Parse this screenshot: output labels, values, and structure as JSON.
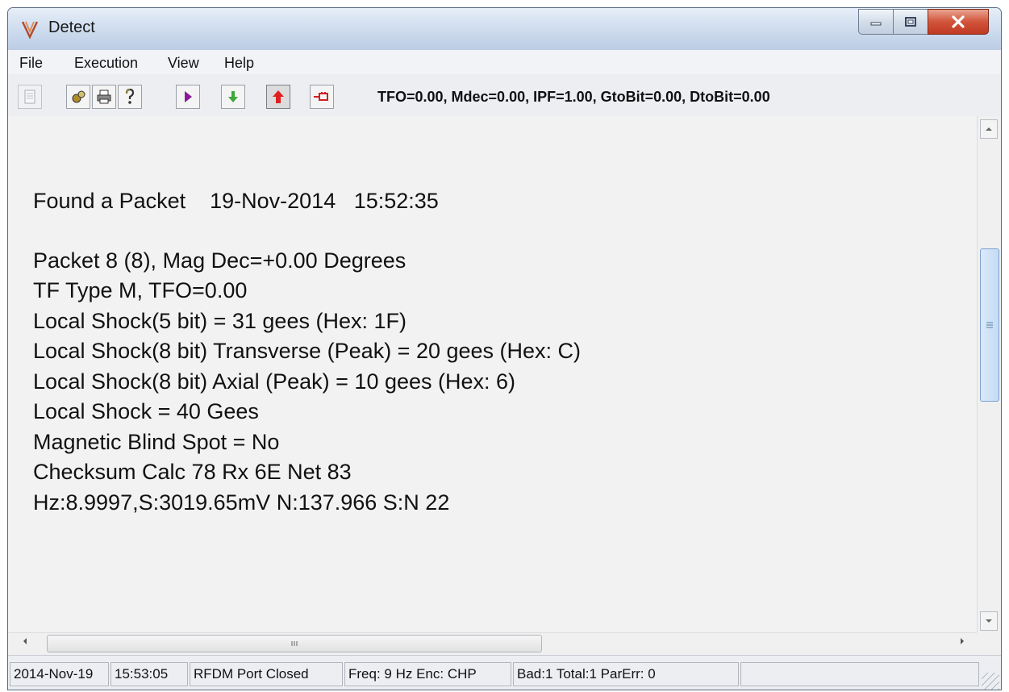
{
  "window": {
    "title": "Detect",
    "controls": [
      "minimize-icon",
      "maximize-icon",
      "close-icon"
    ]
  },
  "menu": {
    "items": [
      {
        "label": "File"
      },
      {
        "label": "Execution"
      },
      {
        "label": "View"
      },
      {
        "label": "Help"
      }
    ]
  },
  "toolbar": {
    "icons": [
      "document-icon",
      "tools-icon",
      "print-icon",
      "help-icon",
      "play-icon",
      "down-arrow-icon",
      "up-arrow-icon",
      "connector-icon"
    ],
    "status": "TFO=0.00, Mdec=0.00, IPF=1.00, GtoBit=0.00, DtoBit=0.00"
  },
  "content": {
    "lines": [
      "Found a Packet    19-Nov-2014   15:52:35",
      "Packet 8 (8), Mag Dec=+0.00 Degrees",
      "TF Type M, TFO=0.00",
      "Local Shock(5 bit) = 31 gees (Hex: 1F)",
      "Local Shock(8 bit) Transverse (Peak) = 20 gees (Hex: C)",
      "Local Shock(8 bit) Axial (Peak) = 10 gees (Hex: 6)",
      "Local Shock = 40 Gees",
      "Magnetic Blind Spot = No",
      "Checksum Calc 78 Rx 6E Net 83",
      "Hz:8.9997,S:3019.65mV N:137.966 S:N 22"
    ]
  },
  "statusbar": {
    "date": "2014-Nov-19",
    "time": "15:53:05",
    "port": "RFDM Port Closed",
    "freq": "Freq: 9 Hz Enc: CHP",
    "counts": "Bad:1 Total:1 ParErr: 0",
    "extra": ""
  },
  "colors": {
    "titlebar": "#cddbee",
    "close_button": "#c8432b",
    "content_bg": "#f2f2f2",
    "scroll_thumb": "#c4dcf5"
  }
}
